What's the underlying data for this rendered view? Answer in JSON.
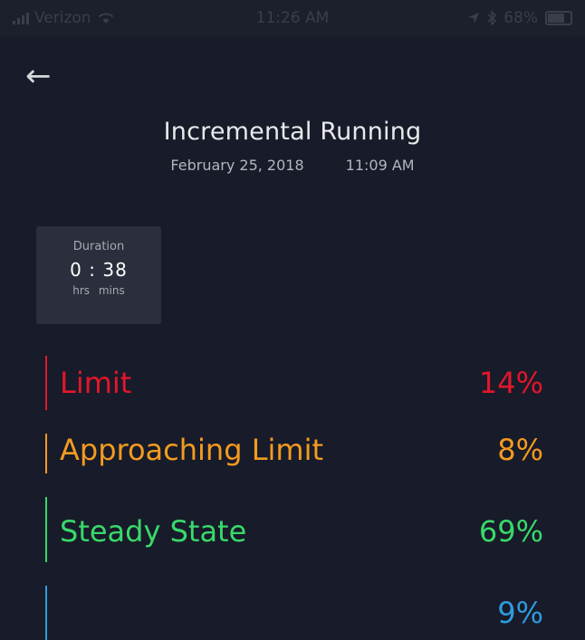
{
  "status_bar": {
    "carrier": "Verizon",
    "time": "11:26 AM",
    "battery": "68%",
    "icons": [
      "signal-icon",
      "wifi-icon",
      "location-arrow-icon",
      "bluetooth-icon",
      "battery-icon"
    ]
  },
  "nav": {
    "back_icon": "arrow-left-icon",
    "back_glyph": "←"
  },
  "header": {
    "title": "Incremental Running",
    "date": "February 25, 2018",
    "time": "11:09 AM"
  },
  "duration": {
    "label": "Duration",
    "value": "0 : 38",
    "units": "hrs mins"
  },
  "zones": [
    {
      "label": "Limit",
      "value": "14%",
      "color": "#e3162b"
    },
    {
      "label": "Approaching Limit",
      "value": "8%",
      "color": "#f29b21"
    },
    {
      "label": "Steady State",
      "value": "69%",
      "color": "#38d96a"
    },
    {
      "label": "",
      "value": "9%",
      "color": "#2f9be0"
    }
  ],
  "colors": {
    "background": "#181b29",
    "card": "#2b2e3c"
  }
}
